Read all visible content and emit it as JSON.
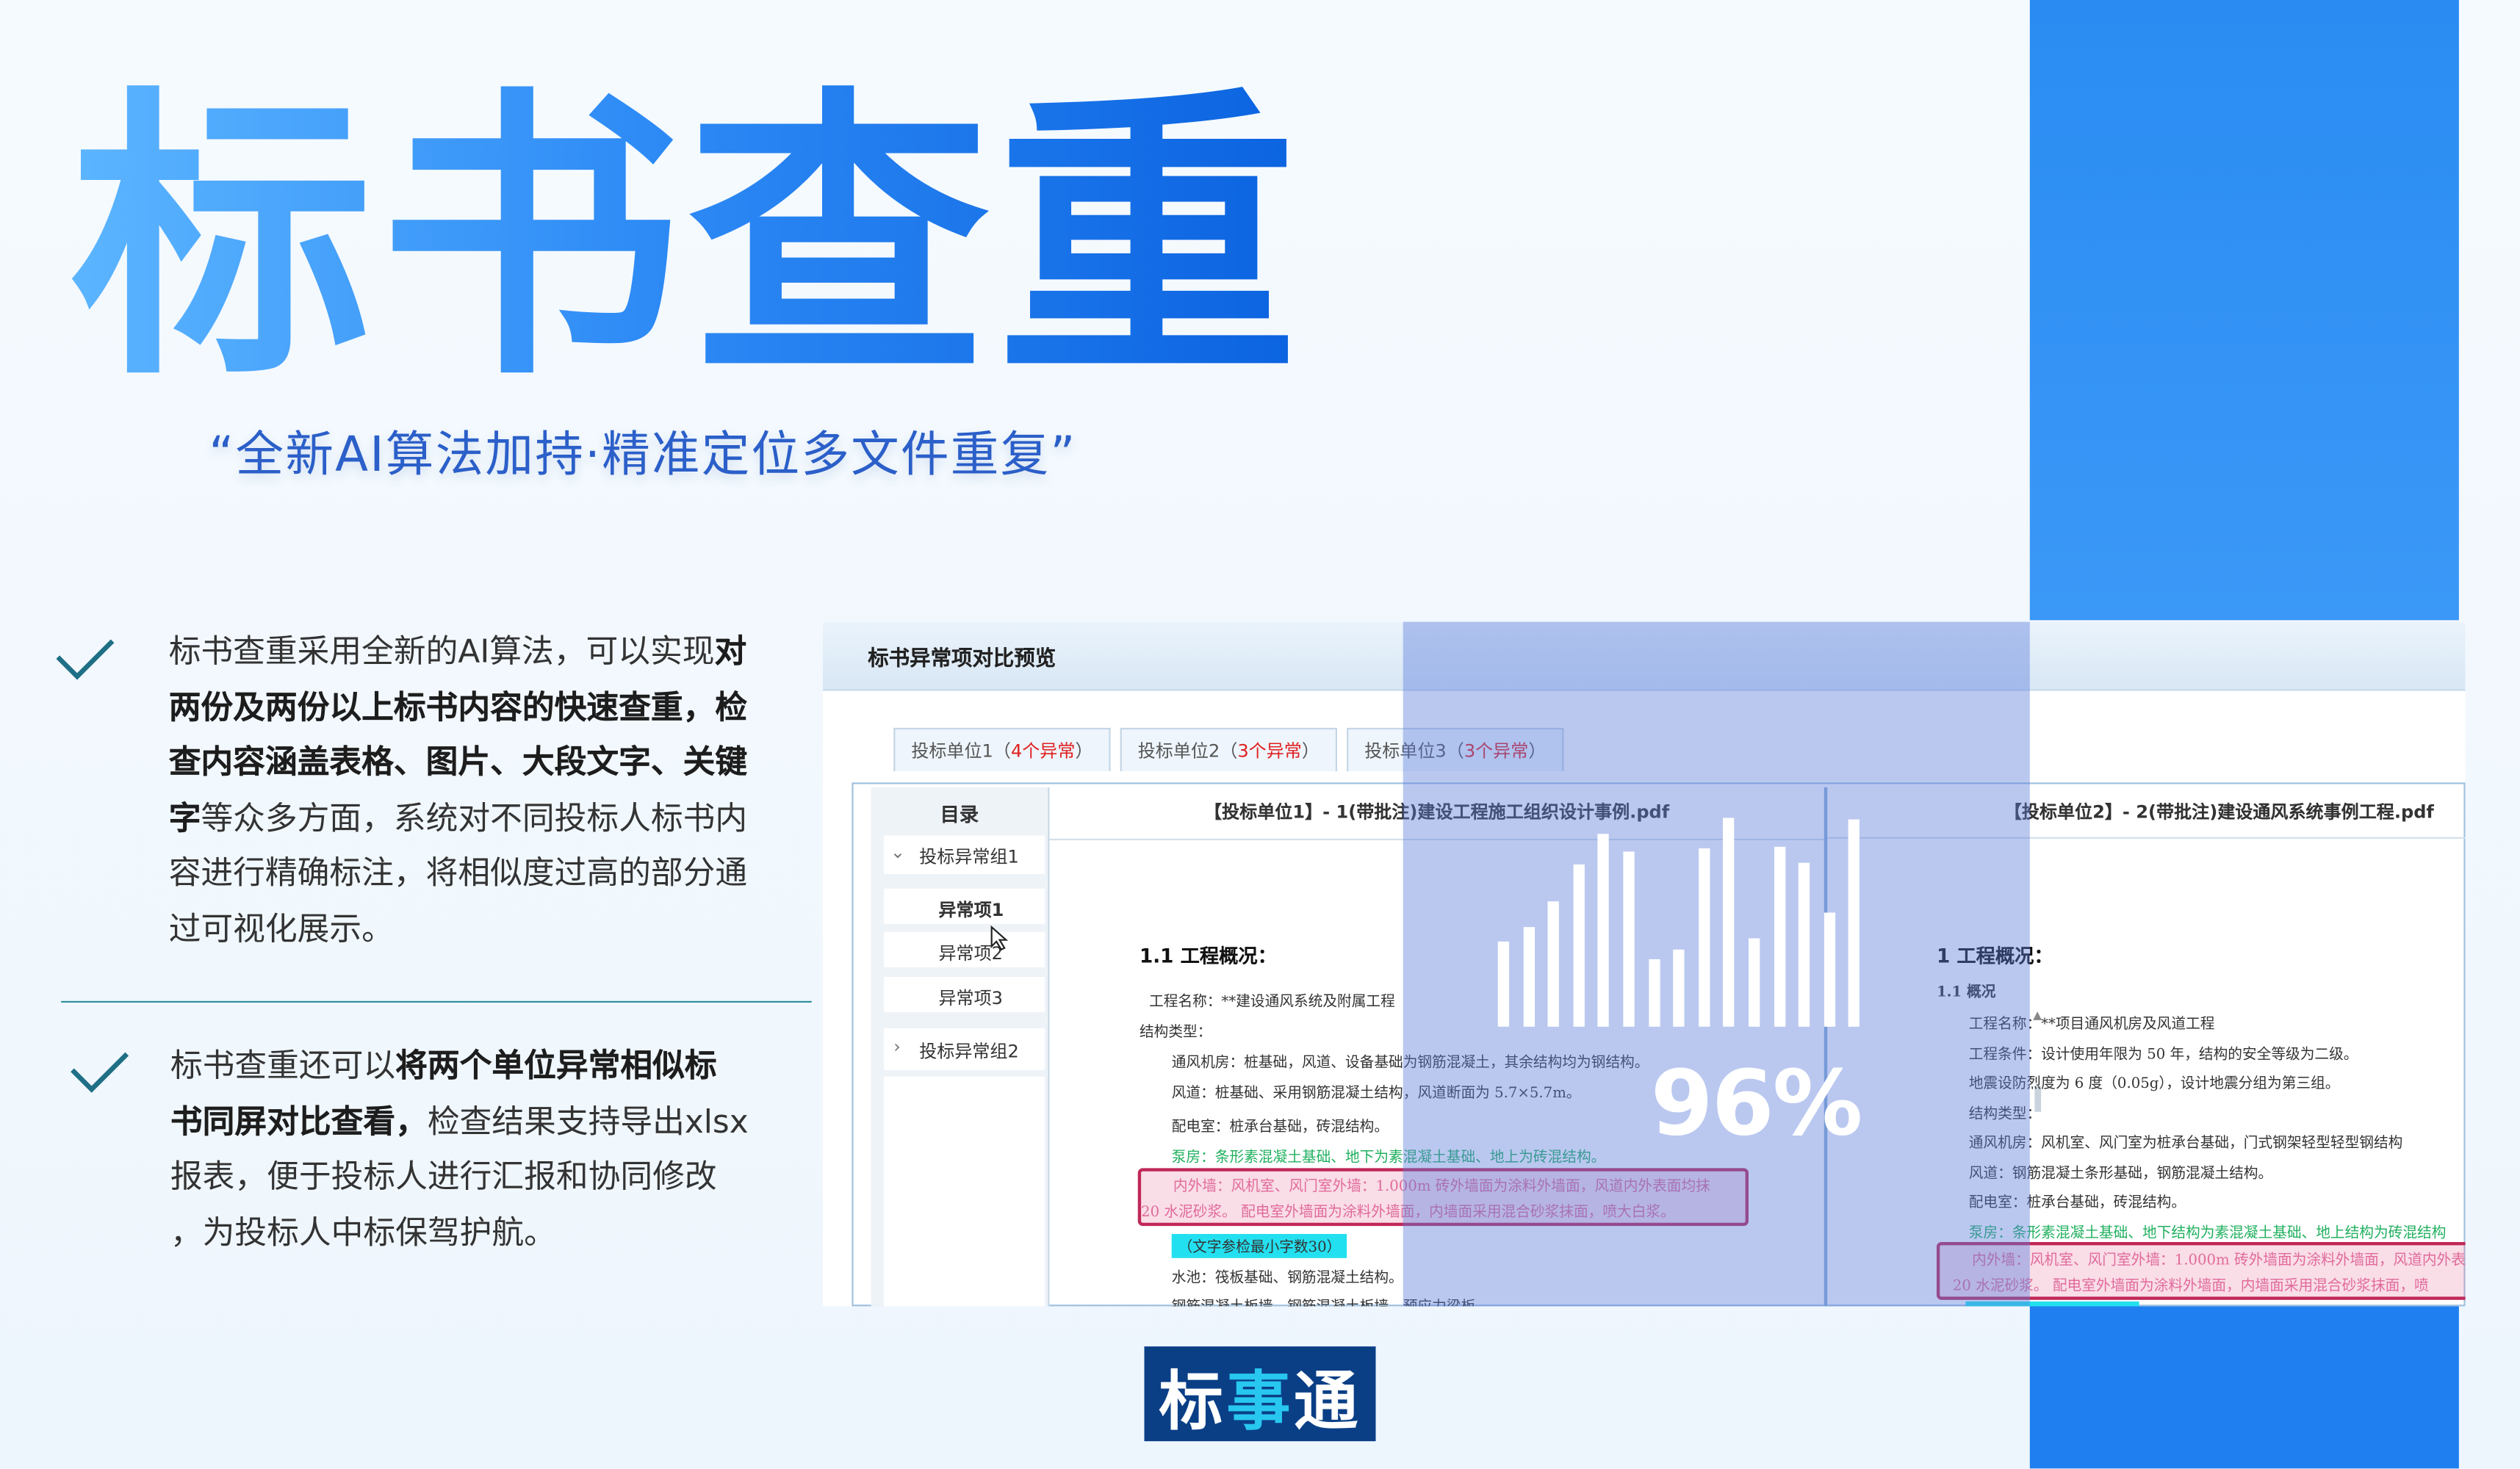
{
  "title": "标书查重",
  "subtitle": "“全新AI算法加持·精准定位多文件重复”",
  "feature1": {
    "l1a": "标书查重采用全新的AI算法，可以实现",
    "l1b": "对",
    "l2": "两份及两份以上标书内容的快速查重，检",
    "l3": "查内容涵盖表格、图片、大段文字、关键",
    "l4a": "字",
    "l4b": "等众多方面，系统对不同投标人标书内",
    "l5": "容进行精确标注，将相似度过高的部分通",
    "l6": "过可视化展示。"
  },
  "feature2": {
    "l1a": "标书查重还可以",
    "l1b": "将两个单位异常相似标",
    "l2a": "书同屏对比查看，",
    "l2b": "检查结果支持导出xlsx",
    "l3": "报表，便于投标人进行汇报和协同修改",
    "l4": "，为投标人中标保驾护航。"
  },
  "screenshot": {
    "window_title": "标书异常项对比预览",
    "tabs": [
      {
        "name": "投标单位1",
        "open": "（",
        "count": "4个异常",
        "close": "）"
      },
      {
        "name": "投标单位2",
        "open": "（",
        "count": "3个异常",
        "close": "）"
      },
      {
        "name": "投标单位3",
        "open": "（",
        "count": "3个异常",
        "close": "）"
      }
    ],
    "toc": {
      "title": "目录",
      "group1": "投标异常组1",
      "items": [
        "异常项1",
        "异常项2",
        "异常项3"
      ],
      "group2": "投标异常组2"
    },
    "left_doc": {
      "header": "【投标单位1】- 1(带批注)建设工程施工组织设计事例.pdf",
      "heading": "1.1 工程概况：",
      "lines": [
        "工程名称：**建设通风系统及附属工程",
        "结构类型：",
        "通风机房：桩基础，风道、设备基础为钢筋混凝土，其余结构均为钢结构。",
        "风道：桩基础、采用钢筋混凝土结构，风道断面为 5.7×5.7m。",
        "配电室：桩承台基础，砖混结构。",
        "泵房：条形素混凝土基础、地下为素混凝土基础、地上为砖混结构。",
        "内外墙：风机室、风门室外墙：1.000m 砖外墙面为涂料外墙面，风道内外表面均抹",
        "20 水泥砂浆。 配电室外墙面为涂料外墙面，内墙面采用混合砂浆抹面，喷大白浆。",
        "（文字参检最小字数30）",
        "水池：筏板基础、钢筋混凝土结构。",
        "钢筋混凝土板墙、钢筋混凝土板墙、预应力梁板"
      ]
    },
    "right_doc": {
      "header": "【投标单位2】- 2(带批注)建设通风系统事例工程.pdf",
      "heading": "1 工程概况：",
      "sub": "1.1 概况",
      "lines": [
        "工程名称：**项目通风机房及风道工程",
        "工程条件：设计使用年限为 50 年，结构的安全等级为二级。",
        "地震设防烈度为 6 度（0.05g），设计地震分组为第三组。",
        "结构类型：",
        "通风机房：风机室、风门室为桩承台基础，门式钢架轻型轻型钢结构",
        "风道：钢筋混凝土条形基础，钢筋混凝土结构。",
        "配电室：桩承台基础，砖混结构。",
        "泵房：条形素混凝土基础、地下结构为素混凝土基础、地上结构为砖混结构",
        "内外墙：风机室、风门室外墙：1.000m 砖外墙面为涂料外墙面，风道内外表",
        "20 水泥砂浆。 配电室外墙面为涂料外墙面，内墙面采用混合砂浆抹面，喷"
      ]
    }
  },
  "overlay": {
    "percent": "96%",
    "bars": [
      0.38,
      0.44,
      0.56,
      0.72,
      0.86,
      0.78,
      0.3,
      0.34,
      0.79,
      0.93,
      0.39,
      0.8,
      0.73,
      0.51,
      0.92
    ]
  },
  "logo": {
    "part1": "标",
    "part2": "事",
    "part3": "通"
  },
  "colors": {
    "brand_blue": "#1f7ff0",
    "title_gradient_start": "#5cb5ff",
    "title_gradient_end": "#0b63e0",
    "logo_bg": "#0a3f86",
    "alert_red": "#e02020",
    "divider": "#2f8f9d"
  }
}
